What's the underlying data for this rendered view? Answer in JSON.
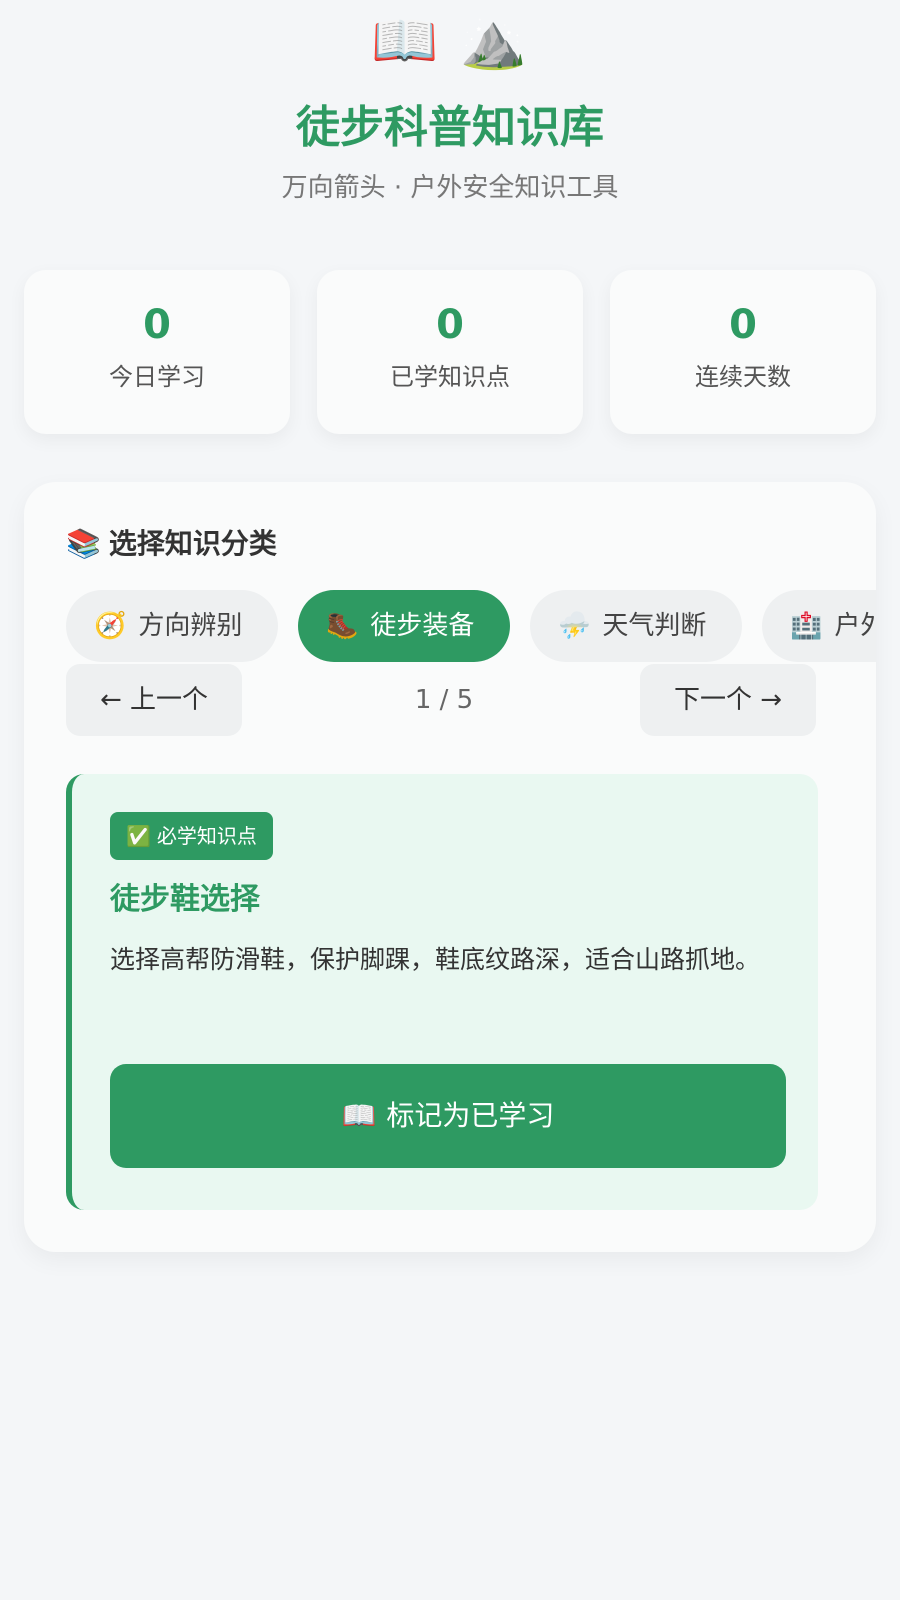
{
  "header": {
    "icons": [
      "📖",
      "⛰️"
    ],
    "icon_names": [
      "open-book-icon",
      "mountain-icon"
    ],
    "title": "徒步科普知识库",
    "subtitle": "万向箭头 · 户外安全知识工具"
  },
  "stats": [
    {
      "value": "0",
      "label": "今日学习"
    },
    {
      "value": "0",
      "label": "已学知识点"
    },
    {
      "value": "0",
      "label": "连续天数"
    }
  ],
  "category": {
    "title_icon": "📚",
    "title": "选择知识分类",
    "tabs": [
      {
        "icon": "🧭",
        "icon_name": "compass-icon",
        "label": "方向辨别",
        "active": false
      },
      {
        "icon": "🥾",
        "icon_name": "hiking-boot-icon",
        "label": "徒步装备",
        "active": true
      },
      {
        "icon": "⛈️",
        "icon_name": "storm-icon",
        "label": "天气判断",
        "active": false
      },
      {
        "icon": "🏥",
        "icon_name": "hospital-icon",
        "label": "户外",
        "active": false
      }
    ]
  },
  "pager": {
    "prev_label": "← 上一个",
    "next_label": "下一个 →",
    "position": "1 / 5"
  },
  "card": {
    "badge_icon": "✅",
    "badge_label": "必学知识点",
    "title": "徒步鞋选择",
    "description": "选择高帮防滑鞋，保护脚踝，鞋底纹路深，适合山路抓地。",
    "button_icon": "📖",
    "button_label": "标记为已学习"
  },
  "colors": {
    "accent": "#2e9a62",
    "background": "#f4f6f8",
    "card_tint": "#e9f8f1"
  }
}
